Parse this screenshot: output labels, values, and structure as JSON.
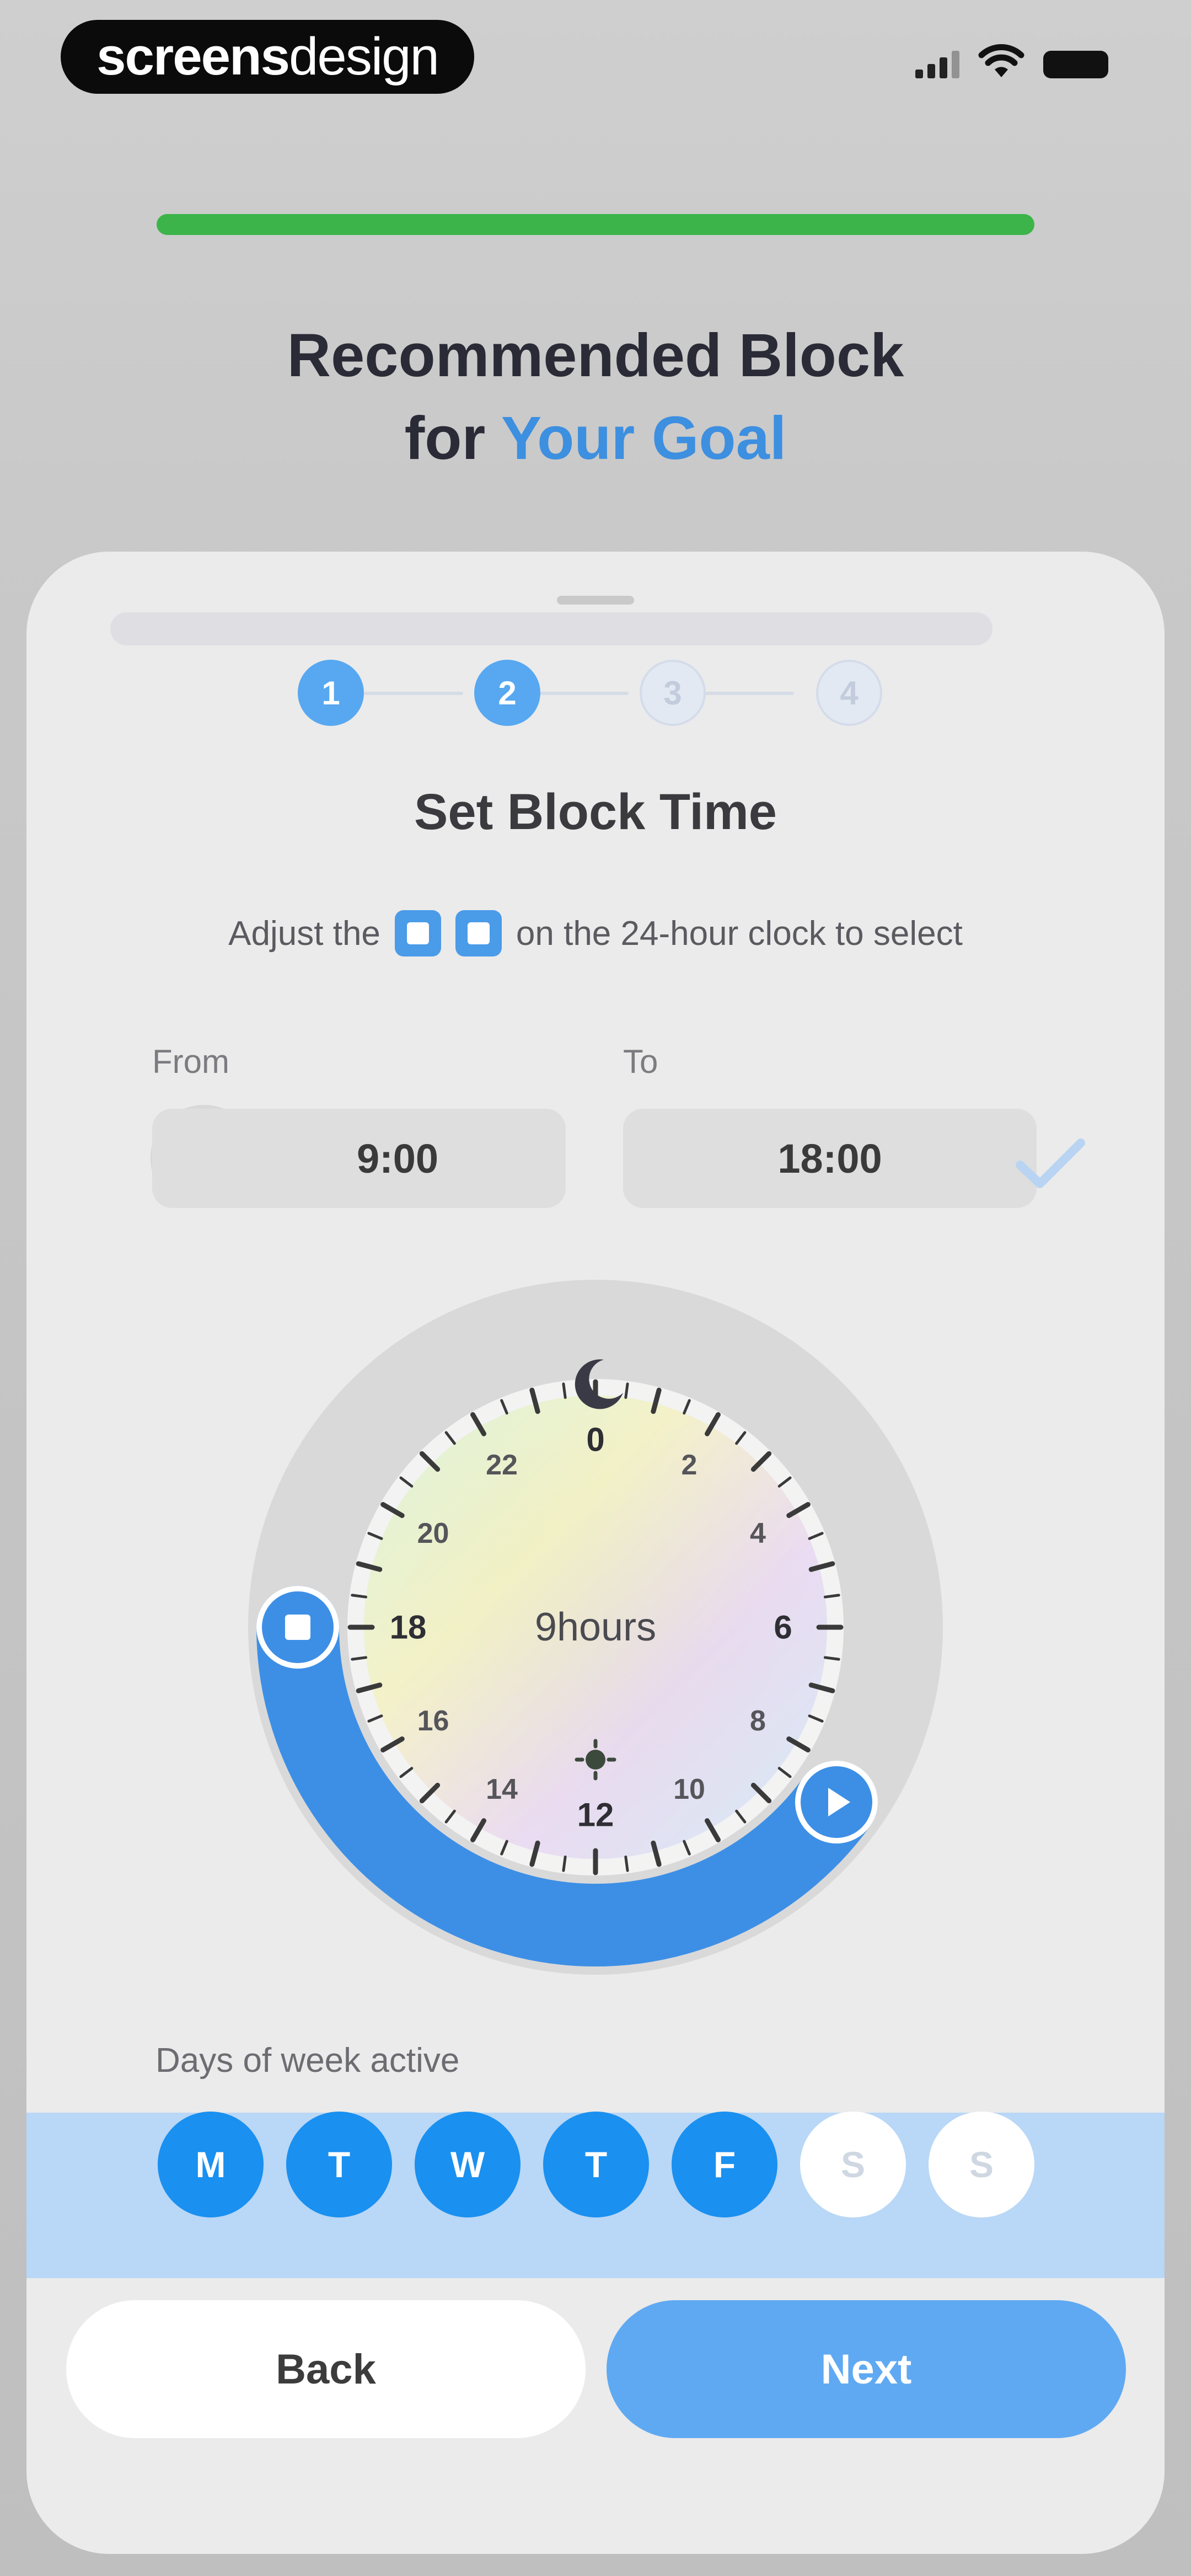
{
  "status_bar": {
    "brand_part1": "screens",
    "brand_part2": "design"
  },
  "header": {
    "title_line1": "Recommended Block",
    "title_line2_prefix": "for ",
    "title_line2_accent": "Your Goal"
  },
  "progress": 1.0,
  "stepper": {
    "steps": [
      "1",
      "2",
      "3",
      "4"
    ],
    "current": 2
  },
  "sheet": {
    "title": "Set Block Time",
    "instruction_before": "Adjust the",
    "instruction_after": "on the 24-hour clock to select"
  },
  "time": {
    "from_label": "From",
    "from_value": "9:00",
    "to_label": "To",
    "to_value": "18:00"
  },
  "clock": {
    "center_text": "9hours",
    "hour_labels": [
      "0",
      "2",
      "4",
      "6",
      "8",
      "10",
      "12",
      "14",
      "16",
      "18",
      "20",
      "22"
    ],
    "selected_from_hour": 9,
    "selected_to_hour": 18,
    "arc_color": "#3d8fe6"
  },
  "days": {
    "label": "Days of week active",
    "items": [
      {
        "label": "M",
        "active": true
      },
      {
        "label": "T",
        "active": true
      },
      {
        "label": "W",
        "active": true
      },
      {
        "label": "T",
        "active": true
      },
      {
        "label": "F",
        "active": true
      },
      {
        "label": "S",
        "active": false
      },
      {
        "label": "S",
        "active": false
      }
    ]
  },
  "buttons": {
    "back": "Back",
    "next": "Next"
  },
  "colors": {
    "accent": "#3d8fe0",
    "progress": "#3cb44a",
    "day_active": "#1a90f0"
  }
}
